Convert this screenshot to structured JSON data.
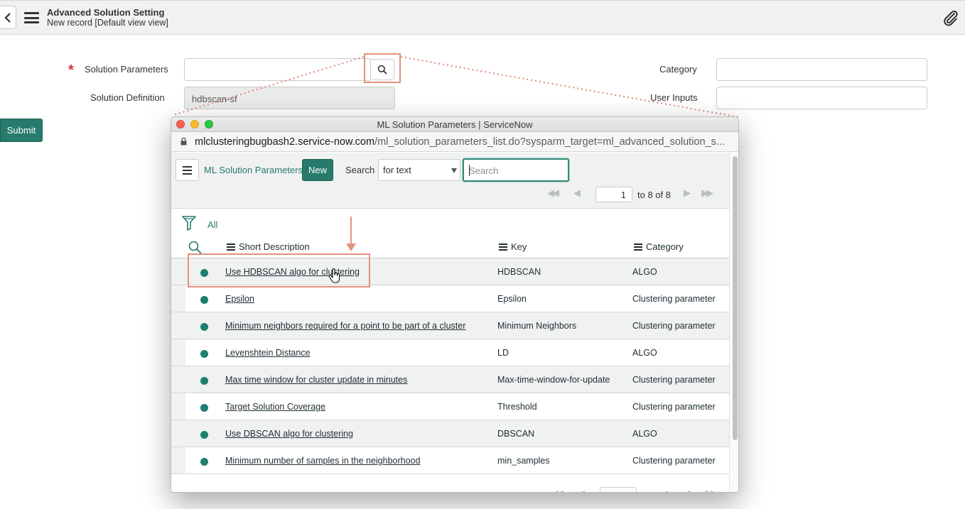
{
  "header": {
    "title": "Advanced Solution Setting",
    "subtitle": "New record [Default view view]",
    "back_icon": "chevron-left-icon",
    "menu_icon": "hamburger-icon",
    "attach_icon": "paperclip-icon"
  },
  "form": {
    "solution_parameters_label": "Solution Parameters",
    "solution_parameters_value": "",
    "solution_definition_label": "Solution Definition",
    "solution_definition_value": "hdbscan-sf",
    "category_label": "Category",
    "category_value": "",
    "user_inputs_label": "User Inputs",
    "user_inputs_value": "",
    "submit_label": "Submit",
    "required_marker": "*"
  },
  "popup": {
    "window_title": "ML Solution Parameters | ServiceNow",
    "url_host": "mlclusteringbugbash2.service-now.com",
    "url_path": "/ml_solution_parameters_list.do?sysparm_target=ml_advanced_solution_s...",
    "list_title": "ML Solution Parameters",
    "new_label": "New",
    "search_label": "Search",
    "search_field_option": "for text",
    "search_placeholder": "Search",
    "page_number": "1",
    "page_range": "to 8 of 8",
    "filter_label": "All",
    "columns": {
      "short_description": "Short Description",
      "key": "Key",
      "category": "Category"
    },
    "rows": [
      {
        "description": "Use HDBSCAN algo for clustering",
        "key": "HDBSCAN",
        "category": "ALGO"
      },
      {
        "description": "Epsilon",
        "key": "Epsilon",
        "category": "Clustering parameter"
      },
      {
        "description": "Minimum neighbors required for a point to be part of a cluster",
        "key": "Minimum Neighbors",
        "category": "Clustering parameter"
      },
      {
        "description": "Levenshtein Distance",
        "key": "LD",
        "category": "ALGO"
      },
      {
        "description": "Max time window for cluster update in minutes",
        "key": "Max-time-window-for-update",
        "category": "Clustering parameter"
      },
      {
        "description": "Target Solution Coverage",
        "key": "Threshold",
        "category": "Clustering parameter"
      },
      {
        "description": "Use DBSCAN algo for clustering",
        "key": "DBSCAN",
        "category": "ALGO"
      },
      {
        "description": "Minimum number of samples in the neighborhood",
        "key": "min_samples",
        "category": "Clustering parameter"
      }
    ]
  },
  "colors": {
    "accent": "#277a6c",
    "status_dot": "#1d7f6e",
    "annotation": "#e2917e",
    "required": "#d0342c"
  }
}
